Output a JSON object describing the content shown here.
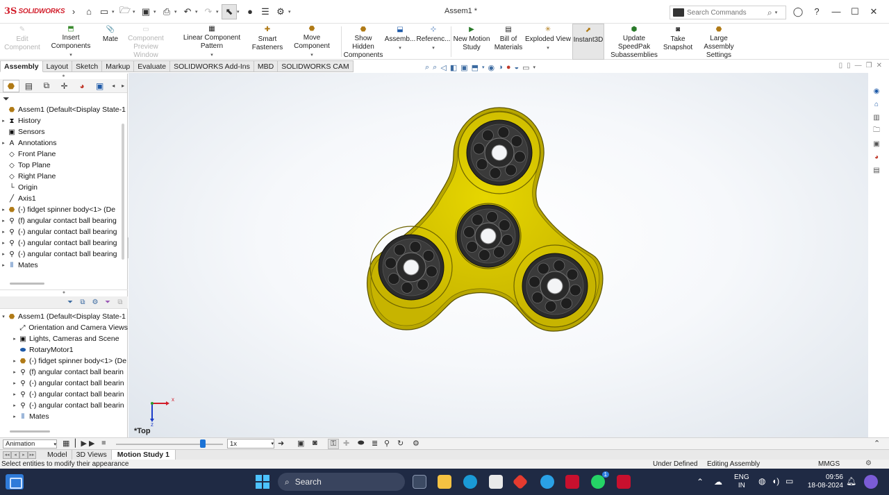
{
  "app": {
    "brand_ds": "3S",
    "brand_name": "SOLIDWORKS",
    "doc_title": "Assem1 *"
  },
  "search": {
    "placeholder": "Search Commands"
  },
  "ribbon": {
    "edit_component": "Edit Component",
    "insert_components": "Insert Components",
    "mate": "Mate",
    "component_preview": "Component Preview Window",
    "linear_pattern": "Linear Component Pattern",
    "smart_fasteners": "Smart Fasteners",
    "move_component": "Move Component",
    "show_hidden": "Show Hidden Components",
    "assembly_features": "Assemb...",
    "reference_geometry": "Referenc...",
    "new_motion_study": "New Motion Study",
    "bill_of_materials": "Bill of Materials",
    "exploded_view": "Exploded View",
    "instant3d": "Instant3D",
    "update_speedpak": "Update SpeedPak Subassemblies",
    "take_snapshot": "Take Snapshot",
    "large_assembly": "Large Assembly Settings"
  },
  "command_tabs": [
    "Assembly",
    "Layout",
    "Sketch",
    "Markup",
    "Evaluate",
    "SOLIDWORKS Add-Ins",
    "MBD",
    "SOLIDWORKS CAM"
  ],
  "feature_tree": [
    {
      "label": "Assem1  (Default<Display State-1",
      "icon": "assembly-icon",
      "expand": ""
    },
    {
      "label": "History",
      "icon": "history-icon",
      "expand": "▸"
    },
    {
      "label": "Sensors",
      "icon": "sensors-icon",
      "expand": ""
    },
    {
      "label": "Annotations",
      "icon": "annotations-icon",
      "expand": "▸"
    },
    {
      "label": "Front Plane",
      "icon": "plane-icon",
      "expand": ""
    },
    {
      "label": "Top Plane",
      "icon": "plane-icon",
      "expand": ""
    },
    {
      "label": "Right Plane",
      "icon": "plane-icon",
      "expand": ""
    },
    {
      "label": "Origin",
      "icon": "origin-icon",
      "expand": ""
    },
    {
      "label": "Axis1",
      "icon": "axis-icon",
      "expand": ""
    },
    {
      "label": "(-) fidget spinner body<1> (De",
      "icon": "part-icon",
      "expand": "▸"
    },
    {
      "label": "(f) angular contact ball bearing",
      "icon": "bearing-icon",
      "expand": "▸"
    },
    {
      "label": "(-) angular contact ball bearing",
      "icon": "bearing-icon",
      "expand": "▸"
    },
    {
      "label": "(-) angular contact ball bearing",
      "icon": "bearing-icon",
      "expand": "▸"
    },
    {
      "label": "(-) angular contact ball bearing",
      "icon": "bearing-icon",
      "expand": "▸"
    },
    {
      "label": "Mates",
      "icon": "mates-icon",
      "expand": "▸"
    }
  ],
  "motion_tree": [
    {
      "label": "Assem1  (Default<Display State-1",
      "icon": "assembly-icon",
      "expand": "▾"
    },
    {
      "label": "Orientation and Camera Views",
      "icon": "camera-icon",
      "expand": ""
    },
    {
      "label": "Lights, Cameras and Scene",
      "icon": "lights-icon",
      "expand": "▸"
    },
    {
      "label": "RotaryMotor1",
      "icon": "motor-icon",
      "expand": ""
    },
    {
      "label": "(-) fidget spinner body<1> (De",
      "icon": "part-icon",
      "expand": "▸"
    },
    {
      "label": "(f) angular contact ball bearin",
      "icon": "bearing-icon",
      "expand": "▸"
    },
    {
      "label": "(-) angular contact ball bearin",
      "icon": "bearing-icon",
      "expand": "▸"
    },
    {
      "label": "(-) angular contact ball bearin",
      "icon": "bearing-icon",
      "expand": "▸"
    },
    {
      "label": "(-) angular contact ball bearin",
      "icon": "bearing-icon",
      "expand": "▸"
    },
    {
      "label": "Mates",
      "icon": "mates-icon",
      "expand": "▸"
    }
  ],
  "viewport": {
    "view_label": "*Top",
    "triad_x": "x",
    "triad_z": "z"
  },
  "motion": {
    "study_type": "Animation",
    "playback_speed": "1x"
  },
  "doc_tabs": [
    "Model",
    "3D Views",
    "Motion Study 1"
  ],
  "status": {
    "message": "Select entities to modify their appearance",
    "definition": "Under Defined",
    "mode": "Editing Assembly",
    "units": "MMGS"
  },
  "taskbar": {
    "search_label": "Search",
    "lang_top": "ENG",
    "lang_bottom": "IN",
    "time": "09:56",
    "date": "18-08-2024",
    "whatsapp_badge": "1"
  },
  "colors": {
    "spinner_body": "#d9c700",
    "bearing": "#2b2b2b",
    "accent": "#1c73d6",
    "brand": "#d21e2b"
  }
}
